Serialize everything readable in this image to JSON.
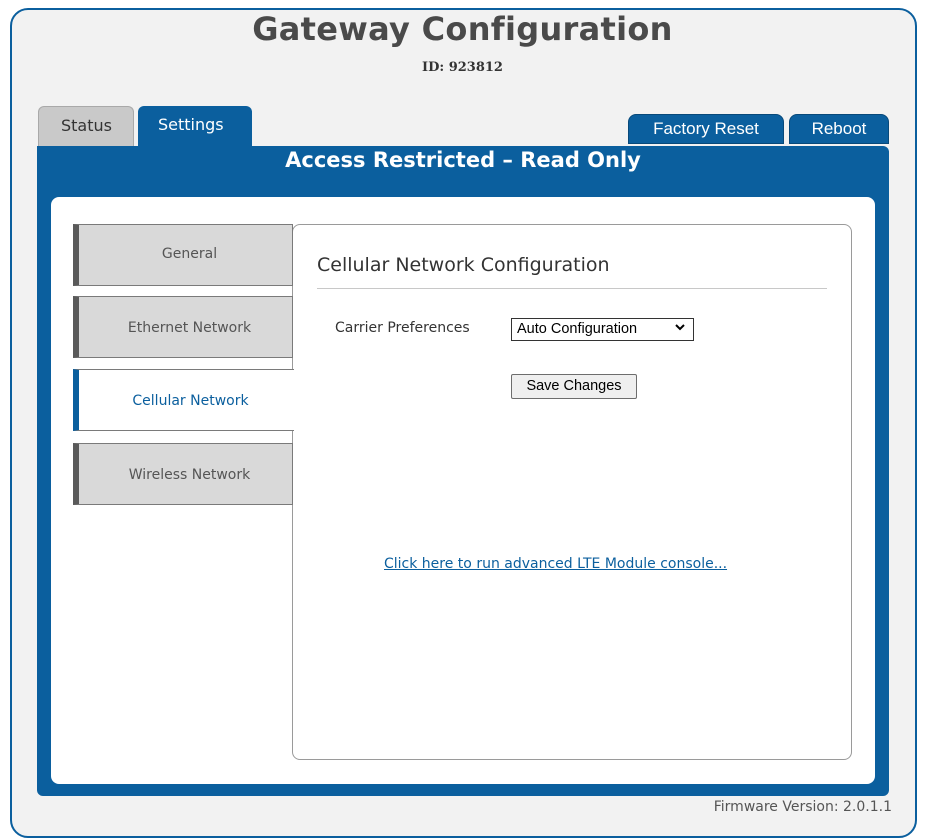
{
  "header": {
    "title": "Gateway Configuration",
    "id_text": "ID: 923812"
  },
  "tabs": [
    {
      "label": "Status",
      "active": false
    },
    {
      "label": "Settings",
      "active": true
    }
  ],
  "actions": {
    "factory_reset_label": "Factory Reset",
    "reboot_label": "Reboot"
  },
  "banner": "Access Restricted – Read Only",
  "sidebar": {
    "items": [
      {
        "label": "General",
        "active": false
      },
      {
        "label": "Ethernet Network",
        "active": false
      },
      {
        "label": "Cellular Network",
        "active": true
      },
      {
        "label": "Wireless Network",
        "active": false
      }
    ]
  },
  "main": {
    "section_title": "Cellular Network Configuration",
    "carrier_label": "Carrier Preferences",
    "carrier_value": "Auto Configuration",
    "save_label": "Save Changes",
    "lte_link": "Click here to run advanced LTE Module console..."
  },
  "footer": {
    "firmware": "Firmware Version: 2.0.1.1"
  },
  "colors": {
    "accent": "#0b5f9e",
    "tab_inactive": "#c9c9c9",
    "nav_inactive": "#d9d9d9"
  },
  "icons": {
    "select_chevron": "chevron-down-icon"
  }
}
